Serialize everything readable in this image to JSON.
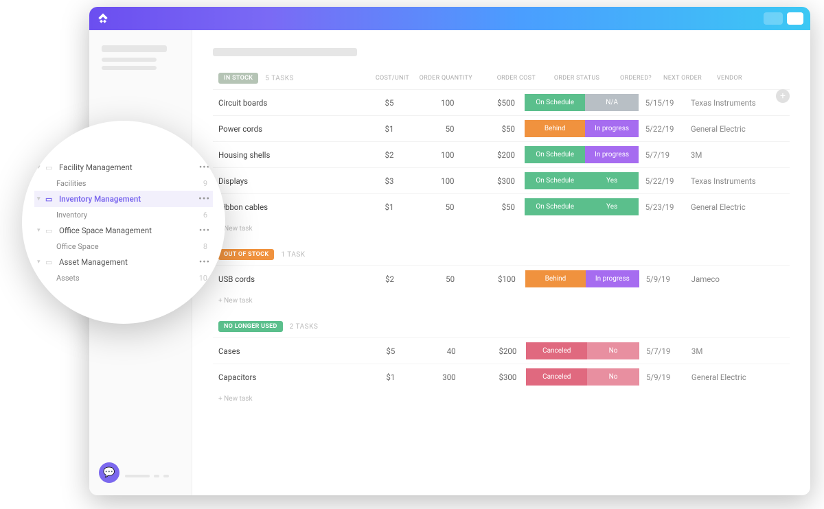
{
  "colors": {
    "green": "#5bbf8c",
    "orange": "#f0923e",
    "purple": "#a66cf0",
    "gray": "#b8bfc5",
    "pinkDark": "#e0697f",
    "pinkLight": "#e88fa0",
    "brand": "#7b68ee"
  },
  "columns": {
    "cost": "COST/UNIT",
    "qty": "ORDER QUANTITY",
    "ordercost": "ORDER COST",
    "status": "ORDER STATUS",
    "ordered": "ORDERED?",
    "next": "NEXT ORDER",
    "vendor": "VENDOR"
  },
  "newtask": "+ New task",
  "sections": [
    {
      "pill": "IN STOCK",
      "pillColor": "#b5c4b5",
      "count": "5 TASKS",
      "rows": [
        {
          "name": "Circuit boards",
          "cost": "$5",
          "qty": "100",
          "oc": "$500",
          "status": "On Schedule",
          "statusColor": "green",
          "ordered": "N/A",
          "orderedColor": "gray",
          "next": "5/15/19",
          "vendor": "Texas Instruments"
        },
        {
          "name": "Power cords",
          "cost": "$1",
          "qty": "50",
          "oc": "$50",
          "status": "Behind",
          "statusColor": "orange",
          "ordered": "In progress",
          "orderedColor": "purple",
          "next": "5/22/19",
          "vendor": "General Electric"
        },
        {
          "name": "Housing shells",
          "cost": "$2",
          "qty": "100",
          "oc": "$200",
          "status": "On Schedule",
          "statusColor": "green",
          "ordered": "In progress",
          "orderedColor": "purple",
          "next": "5/7/19",
          "vendor": "3M"
        },
        {
          "name": "Displays",
          "cost": "$3",
          "qty": "100",
          "oc": "$300",
          "status": "On Schedule",
          "statusColor": "green",
          "ordered": "Yes",
          "orderedColor": "green",
          "next": "5/22/19",
          "vendor": "Texas Instruments"
        },
        {
          "name": "Ribbon cables",
          "cost": "$1",
          "qty": "50",
          "oc": "$50",
          "status": "On Schedule",
          "statusColor": "green",
          "ordered": "Yes",
          "orderedColor": "green",
          "next": "5/23/19",
          "vendor": "General Electric"
        }
      ]
    },
    {
      "pill": "OUT OF STOCK",
      "pillColor": "#f0923e",
      "count": "1 TASK",
      "rows": [
        {
          "name": "USB cords",
          "cost": "$2",
          "qty": "50",
          "oc": "$100",
          "status": "Behind",
          "statusColor": "orange",
          "ordered": "In progress",
          "orderedColor": "purple",
          "next": "5/9/19",
          "vendor": "Jameco"
        }
      ]
    },
    {
      "pill": "NO LONGER USED",
      "pillColor": "#5bbf8c",
      "count": "2 TASKS",
      "rows": [
        {
          "name": "Cases",
          "cost": "$5",
          "qty": "40",
          "oc": "$200",
          "status": "Canceled",
          "statusColor": "pinkDark",
          "ordered": "No",
          "orderedColor": "pinkLight",
          "next": "5/7/19",
          "vendor": "3M"
        },
        {
          "name": "Capacitors",
          "cost": "$1",
          "qty": "300",
          "oc": "$300",
          "status": "Canceled",
          "statusColor": "pinkDark",
          "ordered": "No",
          "orderedColor": "pinkLight",
          "next": "5/9/19",
          "vendor": "General Electric"
        }
      ]
    }
  ],
  "sidebar": {
    "folders": [
      {
        "label": "Facility Management",
        "sub": {
          "label": "Facilities",
          "count": "9"
        }
      },
      {
        "label": "Inventory Management",
        "sub": {
          "label": "Inventory",
          "count": "6"
        },
        "selected": true
      },
      {
        "label": "Office Space Management",
        "sub": {
          "label": "Office Space",
          "count": "8"
        }
      },
      {
        "label": "Asset Management",
        "sub": {
          "label": "Assets",
          "count": "10"
        }
      }
    ]
  }
}
